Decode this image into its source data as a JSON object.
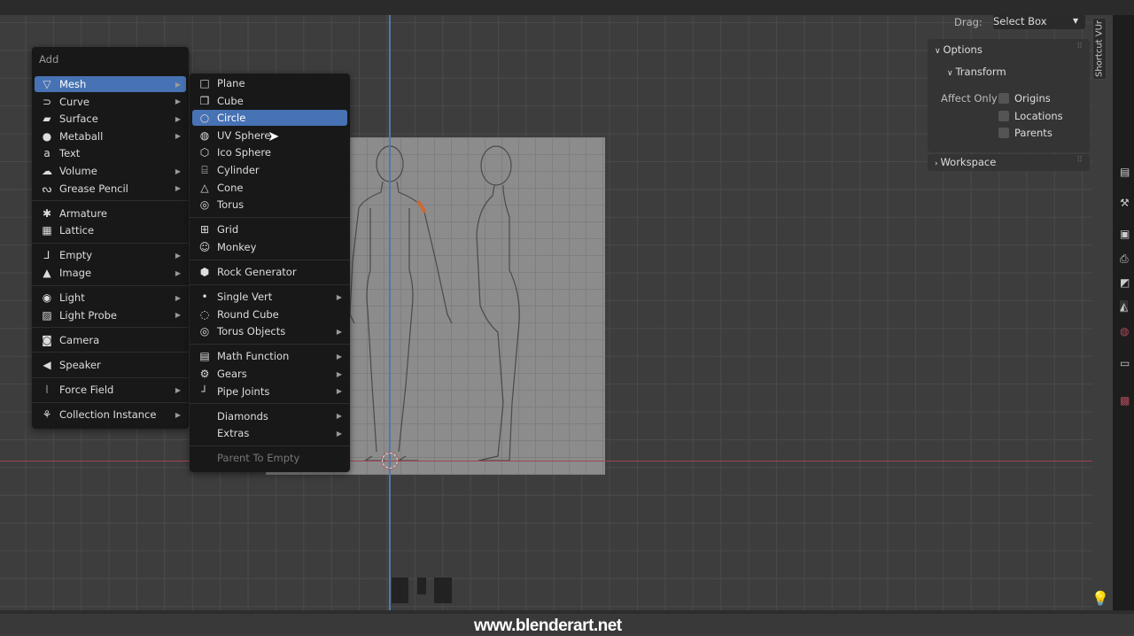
{
  "header": {
    "drag_label": "Drag:",
    "drag_value": "Select Box"
  },
  "sidebar_tab": "Shortcut VUr",
  "npanel": {
    "options_label": "Options",
    "transform_label": "Transform",
    "affect_only_label": "Affect Only",
    "checkboxes": [
      {
        "label": "Origins",
        "checked": false
      },
      {
        "label": "Locations",
        "checked": false
      },
      {
        "label": "Parents",
        "checked": false
      }
    ],
    "workspace_label": "Workspace"
  },
  "add_menu": {
    "title": "Add",
    "groups": [
      [
        {
          "label": "Mesh",
          "icon": "mesh-icon",
          "glyph": "▽",
          "sub": true,
          "active": true
        },
        {
          "label": "Curve",
          "icon": "curve-icon",
          "glyph": "⊃",
          "sub": true
        },
        {
          "label": "Surface",
          "icon": "surface-icon",
          "glyph": "▰",
          "sub": true
        },
        {
          "label": "Metaball",
          "icon": "metaball-icon",
          "glyph": "●",
          "sub": true
        },
        {
          "label": "Text",
          "icon": "text-icon",
          "glyph": "a",
          "sub": false
        },
        {
          "label": "Volume",
          "icon": "volume-icon",
          "glyph": "☁",
          "sub": true
        },
        {
          "label": "Grease Pencil",
          "icon": "grease-pencil-icon",
          "glyph": "ᔓ",
          "sub": true
        }
      ],
      [
        {
          "label": "Armature",
          "icon": "armature-icon",
          "glyph": "✱",
          "sub": false
        },
        {
          "label": "Lattice",
          "icon": "lattice-icon",
          "glyph": "▦",
          "sub": false
        }
      ],
      [
        {
          "label": "Empty",
          "icon": "empty-icon",
          "glyph": "⅃",
          "sub": true
        },
        {
          "label": "Image",
          "icon": "image-icon",
          "glyph": "▲",
          "sub": true
        }
      ],
      [
        {
          "label": "Light",
          "icon": "light-icon",
          "glyph": "◉",
          "sub": true
        },
        {
          "label": "Light Probe",
          "icon": "light-probe-icon",
          "glyph": "▨",
          "sub": true
        }
      ],
      [
        {
          "label": "Camera",
          "icon": "camera-icon",
          "glyph": "◙",
          "sub": false
        }
      ],
      [
        {
          "label": "Speaker",
          "icon": "speaker-icon",
          "glyph": "◀",
          "sub": false
        }
      ],
      [
        {
          "label": "Force Field",
          "icon": "force-field-icon",
          "glyph": "⦚",
          "sub": true
        }
      ],
      [
        {
          "label": "Collection Instance",
          "icon": "collection-icon",
          "glyph": "⚘",
          "sub": true
        }
      ]
    ]
  },
  "mesh_menu": {
    "groups": [
      [
        {
          "label": "Plane",
          "icon": "plane-icon",
          "glyph": "□"
        },
        {
          "label": "Cube",
          "icon": "cube-icon",
          "glyph": "❒"
        },
        {
          "label": "Circle",
          "icon": "circle-icon",
          "glyph": "○",
          "active": true
        },
        {
          "label": "UV Sphere",
          "icon": "uv-sphere-icon",
          "glyph": "◍"
        },
        {
          "label": "Ico Sphere",
          "icon": "ico-sphere-icon",
          "glyph": "⬡"
        },
        {
          "label": "Cylinder",
          "icon": "cylinder-icon",
          "glyph": "⌸"
        },
        {
          "label": "Cone",
          "icon": "cone-icon",
          "glyph": "△"
        },
        {
          "label": "Torus",
          "icon": "torus-icon",
          "glyph": "◎"
        }
      ],
      [
        {
          "label": "Grid",
          "icon": "grid-icon",
          "glyph": "⊞"
        },
        {
          "label": "Monkey",
          "icon": "monkey-icon",
          "glyph": "☺"
        }
      ],
      [
        {
          "label": "Rock Generator",
          "icon": "rock-icon",
          "glyph": "⬢"
        }
      ],
      [
        {
          "label": "Single Vert",
          "icon": "vert-icon",
          "glyph": "•",
          "sub": true
        },
        {
          "label": "Round Cube",
          "icon": "round-cube-icon",
          "glyph": "◌"
        },
        {
          "label": "Torus Objects",
          "icon": "torus-objects-icon",
          "glyph": "◎",
          "sub": true
        }
      ],
      [
        {
          "label": "Math Function",
          "icon": "math-icon",
          "glyph": "▤",
          "sub": true
        },
        {
          "label": "Gears",
          "icon": "gear-icon",
          "glyph": "⚙",
          "sub": true
        },
        {
          "label": "Pipe Joints",
          "icon": "pipe-icon",
          "glyph": "┘",
          "sub": true
        }
      ],
      [
        {
          "label": "Diamonds",
          "icon": "",
          "glyph": "",
          "sub": true
        },
        {
          "label": "Extras",
          "icon": "",
          "glyph": "",
          "sub": true
        }
      ],
      [
        {
          "label": "Parent To Empty",
          "icon": "",
          "glyph": "",
          "disabled": true
        }
      ]
    ]
  },
  "watermark": "www.blenderart.net",
  "colors": {
    "accent": "#4772b3",
    "menu_bg": "#181818",
    "viewport_bg": "#3d3d3d",
    "x_axis": "#a04552",
    "y_axis": "#5677a8"
  }
}
